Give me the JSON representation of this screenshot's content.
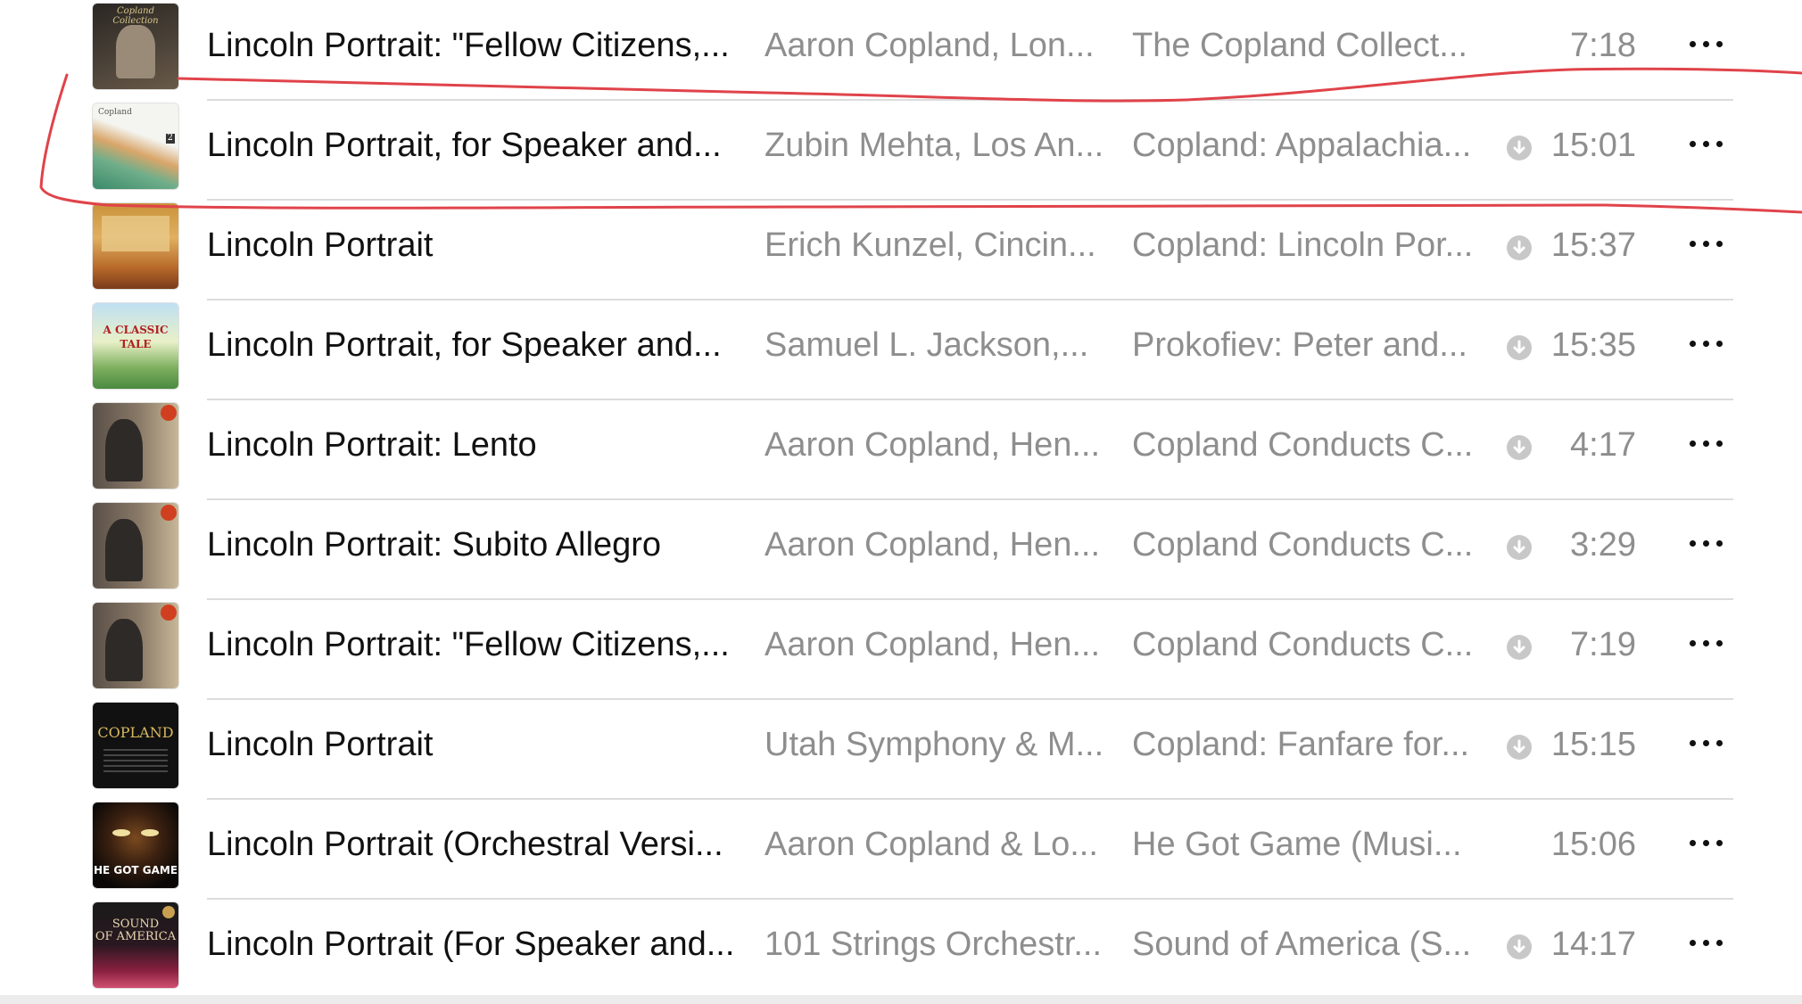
{
  "tracks": [
    {
      "title": "Lincoln Portrait: \"Fellow Citizens,...",
      "artist": "Aaron Copland, Lon...",
      "album": "The Copland Collect...",
      "duration": "7:18",
      "downloadable": false,
      "cover": "the-copland-collection-cover",
      "cover_text": [
        "Copland Collection",
        "",
        ""
      ]
    },
    {
      "title": "Lincoln Portrait, for Speaker and...",
      "artist": "Zubin Mehta, Los An...",
      "album": "Copland: Appalachia...",
      "duration": "15:01",
      "downloadable": true,
      "cover": "copland-appalachian-cover",
      "cover_text": [
        "Copland",
        "",
        "2"
      ]
    },
    {
      "title": "Lincoln Portrait",
      "artist": "Erich Kunzel, Cincin...",
      "album": "Copland: Lincoln Por...",
      "duration": "15:37",
      "downloadable": true,
      "cover": "copland-lincoln-portrait-cover",
      "cover_text": [
        "",
        "",
        ""
      ]
    },
    {
      "title": "Lincoln Portrait, for Speaker and...",
      "artist": "Samuel L. Jackson,...",
      "album": "Prokofiev: Peter and...",
      "duration": "15:35",
      "downloadable": true,
      "cover": "a-classic-tale-cover",
      "cover_text": [
        "A CLASSIC",
        "TALE",
        ""
      ]
    },
    {
      "title": "Lincoln Portrait: Lento",
      "artist": "Aaron Copland, Hen...",
      "album": "Copland Conducts C...",
      "duration": "4:17",
      "downloadable": true,
      "cover": "copland-conducts-cover",
      "cover_text": [
        "",
        "",
        ""
      ]
    },
    {
      "title": "Lincoln Portrait: Subito Allegro",
      "artist": "Aaron Copland, Hen...",
      "album": "Copland Conducts C...",
      "duration": "3:29",
      "downloadable": true,
      "cover": "copland-conducts-cover",
      "cover_text": [
        "",
        "",
        ""
      ]
    },
    {
      "title": "Lincoln Portrait: \"Fellow Citizens,...",
      "artist": "Aaron Copland, Hen...",
      "album": "Copland Conducts C...",
      "duration": "7:19",
      "downloadable": true,
      "cover": "copland-conducts-cover",
      "cover_text": [
        "",
        "",
        ""
      ]
    },
    {
      "title": "Lincoln Portrait",
      "artist": "Utah Symphony & M...",
      "album": "Copland: Fanfare for...",
      "duration": "15:15",
      "downloadable": true,
      "cover": "copland-fanfare-cover",
      "cover_text": [
        "COPLAND",
        "",
        ""
      ]
    },
    {
      "title": "Lincoln Portrait (Orchestral Versi...",
      "artist": "Aaron Copland & Lo...",
      "album": "He Got Game (Musi...",
      "duration": "15:06",
      "downloadable": false,
      "cover": "he-got-game-cover",
      "cover_text": [
        "HE GOT GAME",
        "",
        ""
      ]
    },
    {
      "title": "Lincoln Portrait (For Speaker and...",
      "artist": "101 Strings Orchestr...",
      "album": "Sound of America (S...",
      "duration": "14:17",
      "downloadable": true,
      "cover": "sound-of-america-cover",
      "cover_text": [
        "SOUND",
        "OF AMERICA",
        ""
      ]
    }
  ],
  "icons": {
    "download": "cloud-download-icon",
    "more": "more-options-icon"
  },
  "colors": {
    "annotation": "#e0434a",
    "secondary_text": "#8e8e8e",
    "primary_text": "#111111"
  }
}
